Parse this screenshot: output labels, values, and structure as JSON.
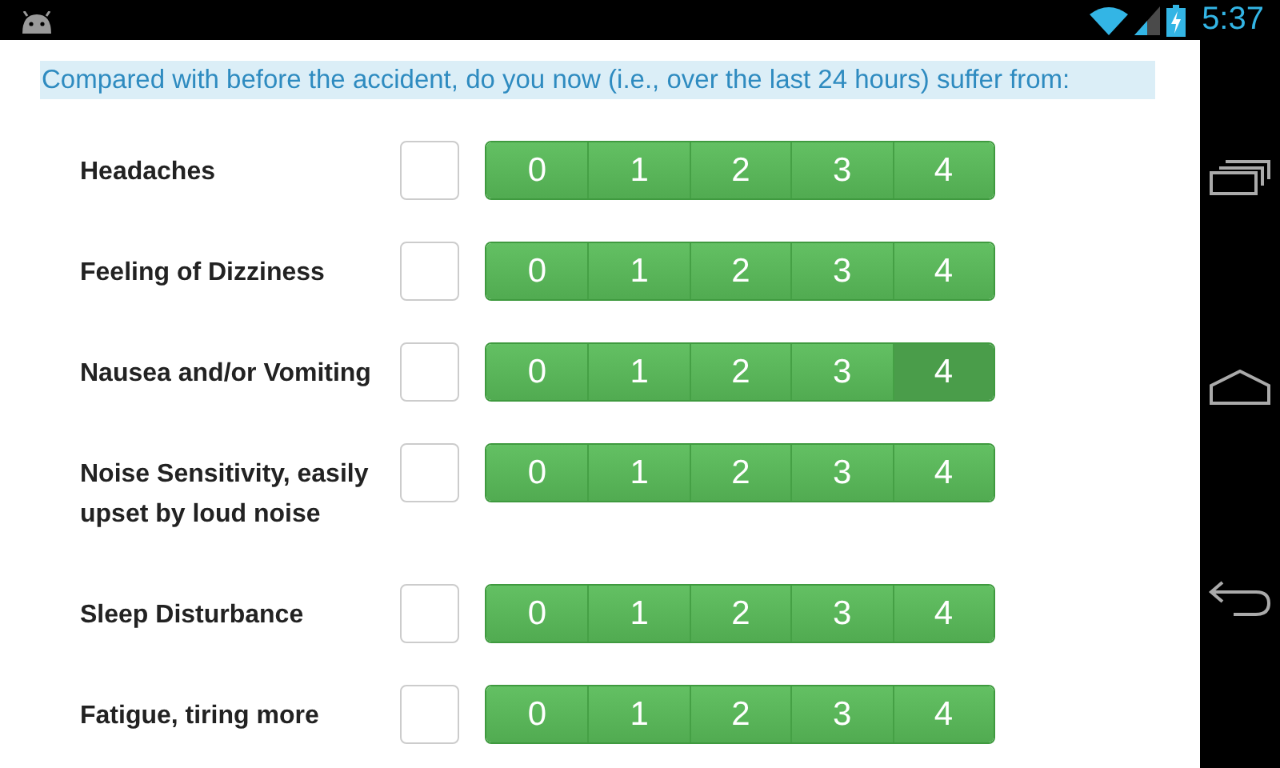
{
  "status_bar": {
    "time": "5:37"
  },
  "question": "Compared with before the accident, do you now (i.e., over the last 24 hours) suffer from:",
  "rows": [
    {
      "label": "Headaches",
      "checked": false,
      "options": [
        {
          "label": "0",
          "selected": false
        },
        {
          "label": "1",
          "selected": false
        },
        {
          "label": "2",
          "selected": false
        },
        {
          "label": "3",
          "selected": false
        },
        {
          "label": "4",
          "selected": false
        }
      ]
    },
    {
      "label": "Feeling of Dizziness",
      "checked": false,
      "options": [
        {
          "label": "0",
          "selected": false
        },
        {
          "label": "1",
          "selected": false
        },
        {
          "label": "2",
          "selected": false
        },
        {
          "label": "3",
          "selected": false
        },
        {
          "label": "4",
          "selected": false
        }
      ]
    },
    {
      "label": "Nausea and/or Vomiting",
      "checked": false,
      "options": [
        {
          "label": "0",
          "selected": false
        },
        {
          "label": "1",
          "selected": false
        },
        {
          "label": "2",
          "selected": false
        },
        {
          "label": "3",
          "selected": false
        },
        {
          "label": "4",
          "selected": true
        }
      ]
    },
    {
      "label": "Noise Sensitivity, easily upset by loud noise",
      "checked": false,
      "options": [
        {
          "label": "0",
          "selected": false
        },
        {
          "label": "1",
          "selected": false
        },
        {
          "label": "2",
          "selected": false
        },
        {
          "label": "3",
          "selected": false
        },
        {
          "label": "4",
          "selected": false
        }
      ]
    },
    {
      "label": "Sleep Disturbance",
      "checked": false,
      "options": [
        {
          "label": "0",
          "selected": false
        },
        {
          "label": "1",
          "selected": false
        },
        {
          "label": "2",
          "selected": false
        },
        {
          "label": "3",
          "selected": false
        },
        {
          "label": "4",
          "selected": false
        }
      ]
    },
    {
      "label": "Fatigue, tiring more",
      "checked": false,
      "options": [
        {
          "label": "0",
          "selected": false
        },
        {
          "label": "1",
          "selected": false
        },
        {
          "label": "2",
          "selected": false
        },
        {
          "label": "3",
          "selected": false
        },
        {
          "label": "4",
          "selected": false
        }
      ]
    }
  ]
}
